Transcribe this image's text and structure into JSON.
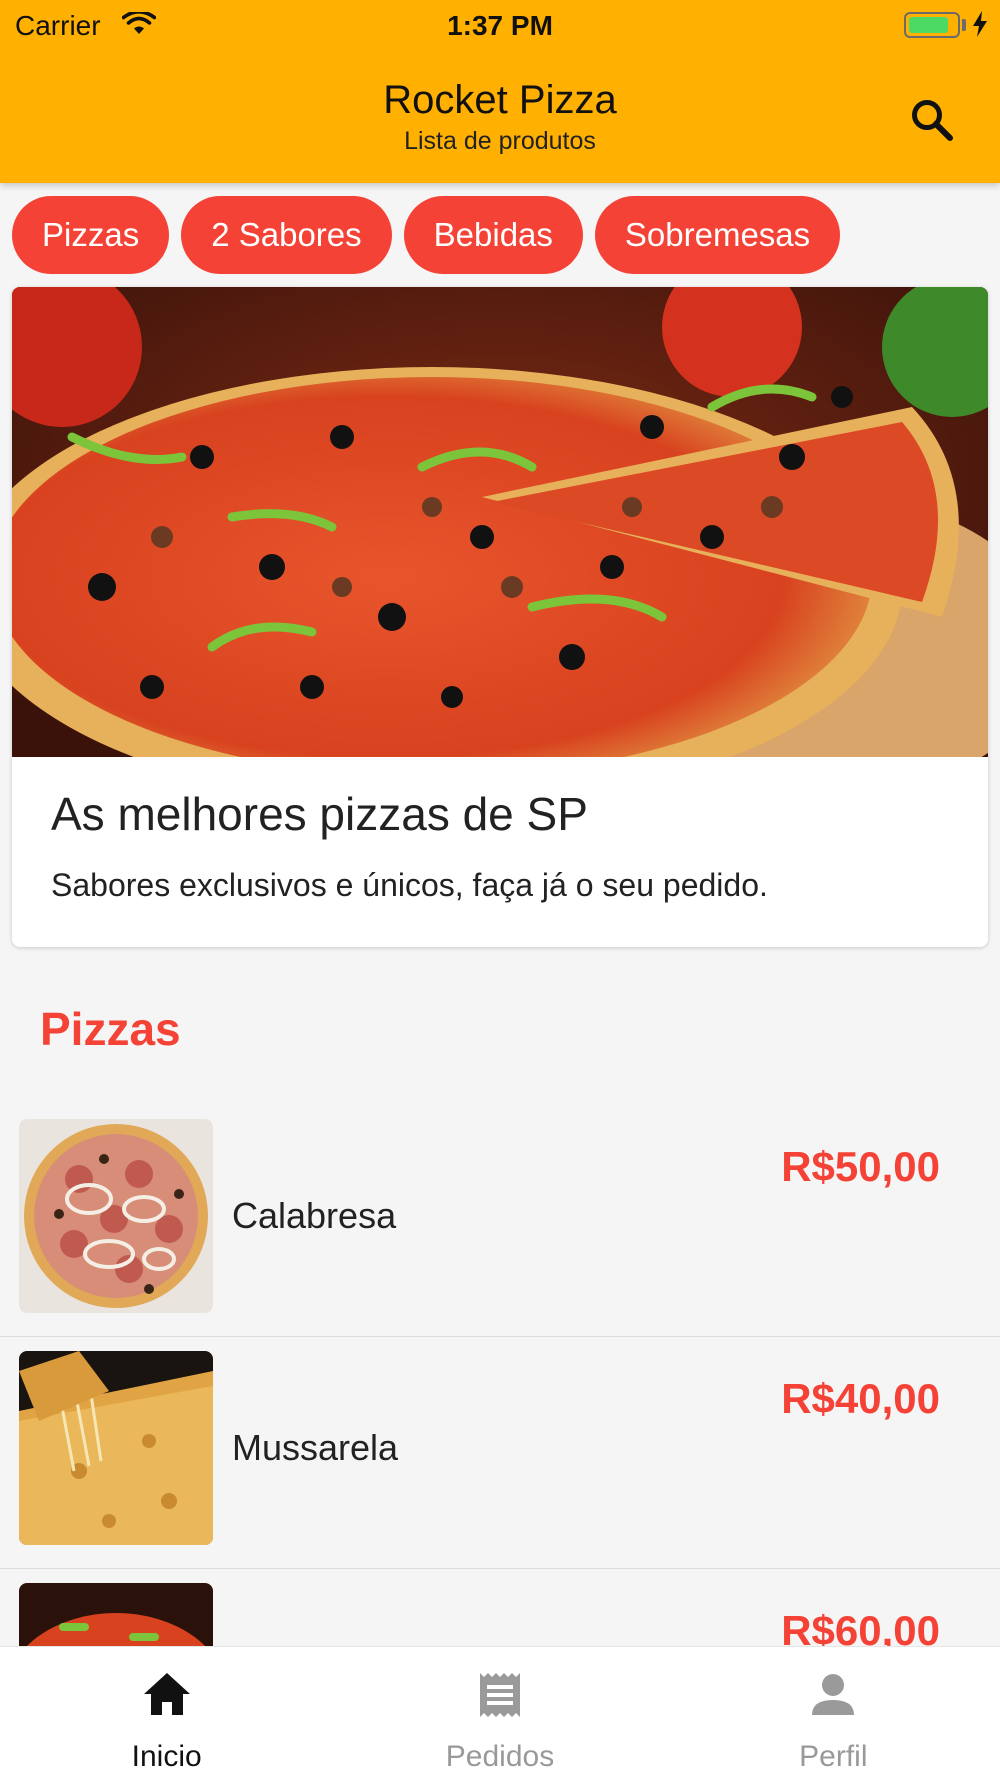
{
  "status_bar": {
    "carrier": "Carrier",
    "time": "1:37 PM",
    "battery_level": 0.85
  },
  "app_bar": {
    "title": "Rocket Pizza",
    "subtitle": "Lista de produtos",
    "search_icon": "search-icon"
  },
  "chips": [
    {
      "label": "Pizzas"
    },
    {
      "label": "2 Sabores"
    },
    {
      "label": "Bebidas"
    },
    {
      "label": "Sobremesas"
    }
  ],
  "banner": {
    "title": "As melhores pizzas de SP",
    "text": "Sabores exclusivos e únicos, faça já o seu pedido."
  },
  "section": {
    "title": "Pizzas"
  },
  "products": [
    {
      "name": "Calabresa",
      "price": "R$50,00"
    },
    {
      "name": "Mussarela",
      "price": "R$40,00"
    },
    {
      "name": "",
      "price": "R$60,00"
    }
  ],
  "tabs": [
    {
      "label": "Inicio",
      "icon": "home-icon",
      "active": true
    },
    {
      "label": "Pedidos",
      "icon": "receipt-icon",
      "active": false
    },
    {
      "label": "Perfil",
      "icon": "person-icon",
      "active": false
    }
  ],
  "colors": {
    "app_bar": "#ffb000",
    "accent": "#f44336",
    "background": "#f5f5f5"
  }
}
